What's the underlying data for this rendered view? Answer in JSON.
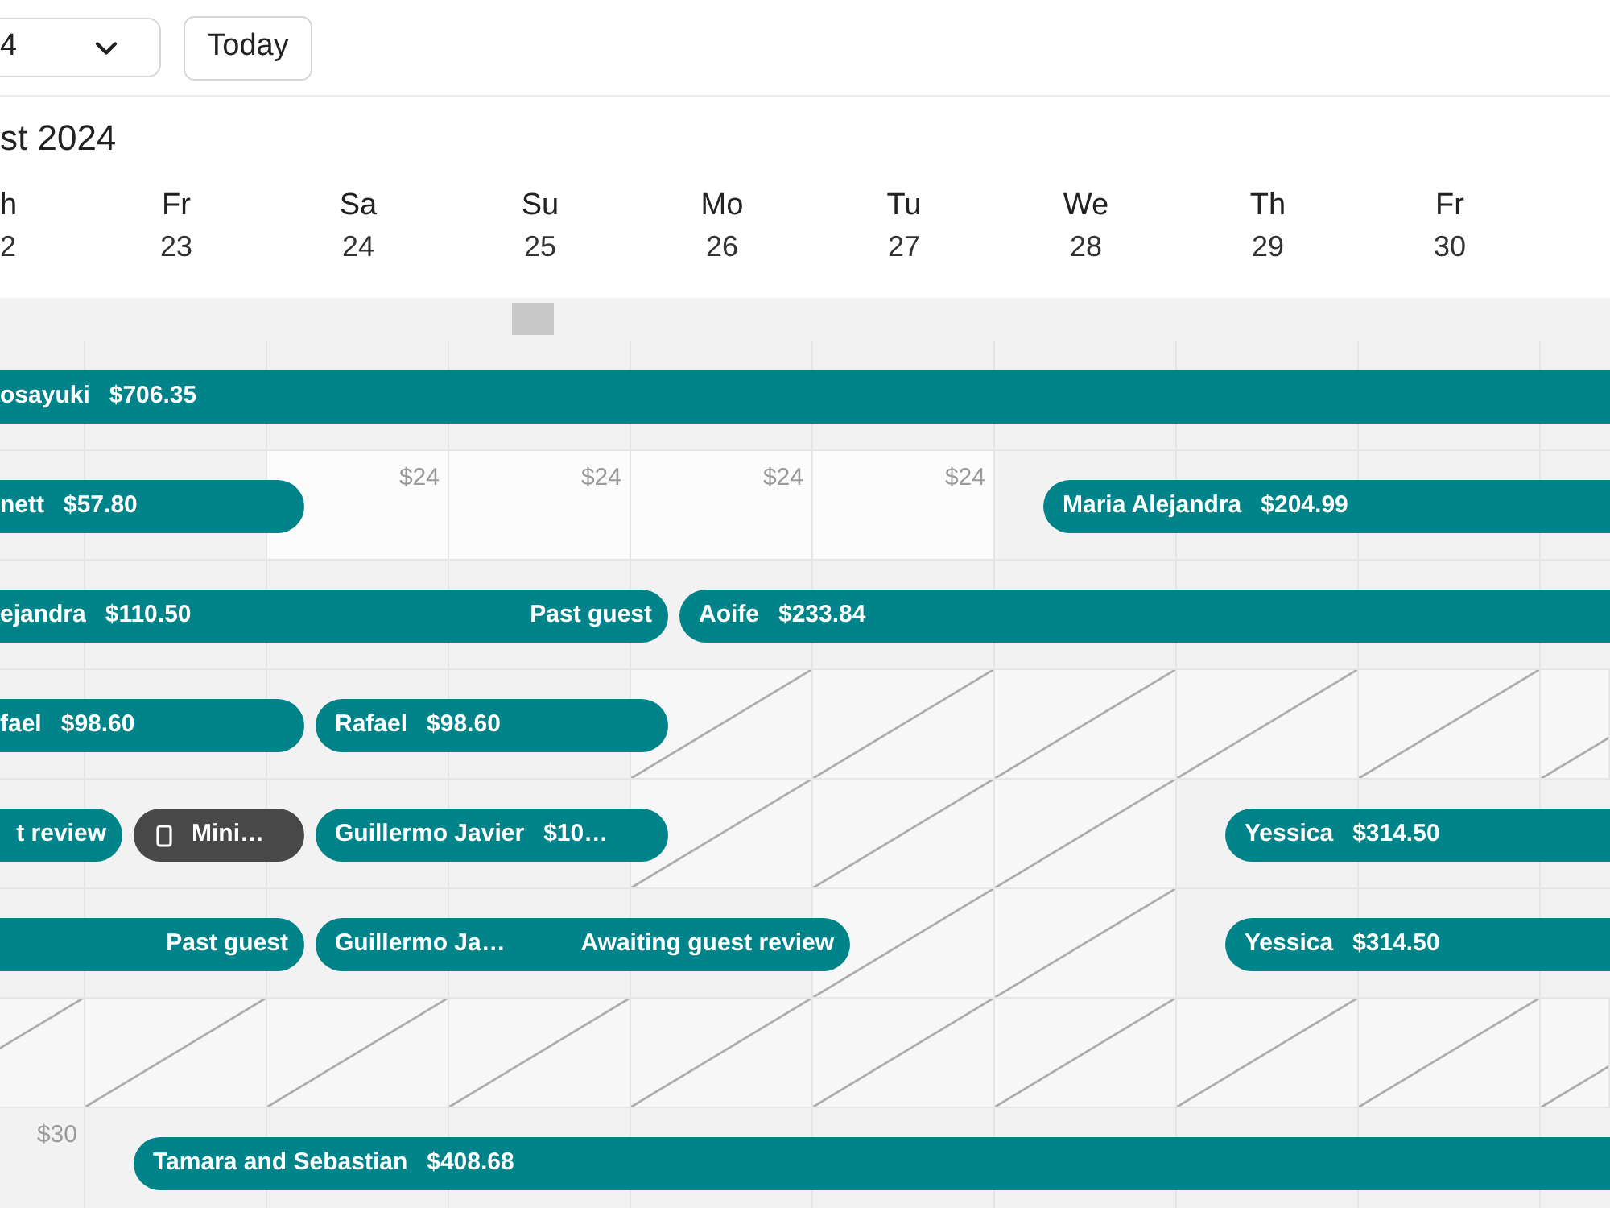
{
  "toolbar": {
    "month_select": {
      "value": "4"
    },
    "today_button": "Today"
  },
  "month_title": "st 2024",
  "days": [
    {
      "weekday": "h",
      "date": "2"
    },
    {
      "weekday": "Fr",
      "date": "23"
    },
    {
      "weekday": "Sa",
      "date": "24"
    },
    {
      "weekday": "Su",
      "date": "25"
    },
    {
      "weekday": "Mo",
      "date": "26"
    },
    {
      "weekday": "Tu",
      "date": "27"
    },
    {
      "weekday": "We",
      "date": "28"
    },
    {
      "weekday": "Th",
      "date": "29"
    },
    {
      "weekday": "Fr",
      "date": "30"
    }
  ],
  "rows": [
    {
      "cells": [
        {
          "kind": "plain",
          "check_in": false,
          "check_out": false
        },
        {
          "kind": "plain",
          "check_in": false,
          "check_out": false
        },
        {
          "kind": "plain",
          "check_in": false,
          "check_out": false
        },
        {
          "kind": "plain",
          "check_in": false,
          "check_out": false
        },
        {
          "kind": "plain",
          "check_in": false,
          "check_out": false
        },
        {
          "kind": "plain",
          "check_in": false,
          "check_out": false
        },
        {
          "kind": "plain",
          "check_in": false,
          "check_out": false
        },
        {
          "kind": "plain",
          "check_in": false,
          "check_out": false
        },
        {
          "kind": "plain",
          "check_in": false,
          "check_out": false
        },
        {
          "kind": "plain",
          "check_in": false,
          "check_out": false
        }
      ],
      "bookings": [
        {
          "kind": "reservation",
          "guest": "osayuki",
          "amount": "$706.35"
        }
      ]
    },
    {
      "cells": [
        {
          "kind": "plain",
          "check_in": false,
          "check_out": false
        },
        {
          "kind": "plain",
          "check_in": false,
          "check_out": false
        },
        {
          "kind": "open",
          "price": "$24",
          "check_in": false,
          "check_out": true
        },
        {
          "kind": "open",
          "price": "$24",
          "check_in": false,
          "check_out": false
        },
        {
          "kind": "open",
          "price": "$24",
          "check_in": false,
          "check_out": false
        },
        {
          "kind": "open",
          "price": "$24",
          "check_in": false,
          "check_out": false
        },
        {
          "kind": "plain",
          "check_in": true,
          "check_out": false
        },
        {
          "kind": "plain",
          "check_in": false,
          "check_out": false
        },
        {
          "kind": "plain",
          "check_in": false,
          "check_out": false
        },
        {
          "kind": "plain",
          "check_in": false,
          "check_out": false
        }
      ],
      "bookings": [
        {
          "kind": "reservation",
          "guest": "nett",
          "amount": "$57.80"
        },
        {
          "kind": "reservation",
          "guest": "Maria Alejandra",
          "amount": "$204.99"
        }
      ]
    },
    {
      "cells": [
        {
          "kind": "plain",
          "check_in": false,
          "check_out": false
        },
        {
          "kind": "plain",
          "check_in": false,
          "check_out": false
        },
        {
          "kind": "plain",
          "check_in": false,
          "check_out": false
        },
        {
          "kind": "plain",
          "check_in": false,
          "check_out": false
        },
        {
          "kind": "plain",
          "check_in": true,
          "check_out": true
        },
        {
          "kind": "plain",
          "check_in": false,
          "check_out": false
        },
        {
          "kind": "plain",
          "check_in": false,
          "check_out": false
        },
        {
          "kind": "plain",
          "check_in": false,
          "check_out": false
        },
        {
          "kind": "plain",
          "check_in": false,
          "check_out": false
        },
        {
          "kind": "plain",
          "check_in": false,
          "check_out": false
        }
      ],
      "bookings": [
        {
          "kind": "reservation",
          "guest": "ejandra",
          "amount": "$110.50",
          "status": "Past guest"
        },
        {
          "kind": "reservation",
          "guest": "Aoife",
          "amount": "$233.84"
        }
      ]
    },
    {
      "cells": [
        {
          "kind": "plain",
          "check_in": false,
          "check_out": false
        },
        {
          "kind": "plain",
          "check_in": false,
          "check_out": false
        },
        {
          "kind": "plain",
          "check_in": true,
          "check_out": true
        },
        {
          "kind": "plain",
          "check_in": false,
          "check_out": false
        },
        {
          "kind": "blocked",
          "check_in": false,
          "check_out": true
        },
        {
          "kind": "blocked",
          "check_in": false,
          "check_out": false
        },
        {
          "kind": "blocked",
          "check_in": false,
          "check_out": false
        },
        {
          "kind": "blocked",
          "check_in": false,
          "check_out": false
        },
        {
          "kind": "blocked",
          "check_in": false,
          "check_out": false
        },
        {
          "kind": "blocked",
          "check_in": false,
          "check_out": false
        }
      ],
      "bookings": [
        {
          "kind": "reservation",
          "guest": "fael",
          "amount": "$98.60"
        },
        {
          "kind": "reservation",
          "guest": "Rafael",
          "amount": "$98.60"
        }
      ]
    },
    {
      "cells": [
        {
          "kind": "plain",
          "check_in": false,
          "check_out": false
        },
        {
          "kind": "plain",
          "check_in": true,
          "check_out": true
        },
        {
          "kind": "plain",
          "check_in": true,
          "check_out": true
        },
        {
          "kind": "plain",
          "check_in": false,
          "check_out": false
        },
        {
          "kind": "blocked",
          "check_in": false,
          "check_out": true
        },
        {
          "kind": "blocked",
          "check_in": false,
          "check_out": false
        },
        {
          "kind": "blocked",
          "check_in": false,
          "check_out": false
        },
        {
          "kind": "plain",
          "check_in": true,
          "check_out": false
        },
        {
          "kind": "plain",
          "check_in": false,
          "check_out": false
        },
        {
          "kind": "plain",
          "check_in": false,
          "check_out": false
        }
      ],
      "bookings": [
        {
          "kind": "reservation",
          "status": "t review"
        },
        {
          "kind": "hold",
          "guest": "Mini…"
        },
        {
          "kind": "reservation",
          "guest": "Guillermo Javier",
          "amount": "$10…"
        },
        {
          "kind": "reservation",
          "guest": "Yessica",
          "amount": "$314.50"
        }
      ]
    },
    {
      "cells": [
        {
          "kind": "plain",
          "check_in": false,
          "check_out": false
        },
        {
          "kind": "plain",
          "check_in": false,
          "check_out": false
        },
        {
          "kind": "plain",
          "check_in": true,
          "check_out": true
        },
        {
          "kind": "plain",
          "check_in": false,
          "check_out": false
        },
        {
          "kind": "plain",
          "check_in": false,
          "check_out": false
        },
        {
          "kind": "blocked",
          "check_in": false,
          "check_out": true
        },
        {
          "kind": "blocked",
          "check_in": false,
          "check_out": false
        },
        {
          "kind": "plain",
          "check_in": true,
          "check_out": false
        },
        {
          "kind": "plain",
          "check_in": false,
          "check_out": false
        },
        {
          "kind": "plain",
          "check_in": false,
          "check_out": false
        }
      ],
      "bookings": [
        {
          "kind": "reservation",
          "status": "Past guest"
        },
        {
          "kind": "reservation",
          "guest": "Guillermo Ja…",
          "status": "Awaiting guest review"
        },
        {
          "kind": "reservation",
          "guest": "Yessica",
          "amount": "$314.50"
        }
      ]
    },
    {
      "cells": [
        {
          "kind": "blocked",
          "check_in": false,
          "check_out": false
        },
        {
          "kind": "blocked",
          "check_in": false,
          "check_out": false
        },
        {
          "kind": "blocked",
          "check_in": false,
          "check_out": false
        },
        {
          "kind": "blocked",
          "check_in": false,
          "check_out": false
        },
        {
          "kind": "blocked",
          "check_in": false,
          "check_out": false
        },
        {
          "kind": "blocked",
          "check_in": false,
          "check_out": false
        },
        {
          "kind": "blocked",
          "check_in": false,
          "check_out": false
        },
        {
          "kind": "blocked",
          "check_in": false,
          "check_out": false
        },
        {
          "kind": "blocked",
          "check_in": false,
          "check_out": false
        },
        {
          "kind": "blocked",
          "check_in": false,
          "check_out": false
        }
      ],
      "bookings": []
    },
    {
      "cells": [
        {
          "kind": "plain",
          "price": "$30",
          "check_in": false,
          "check_out": false
        },
        {
          "kind": "plain",
          "check_in": true,
          "check_out": false
        },
        {
          "kind": "plain",
          "check_in": false,
          "check_out": false
        },
        {
          "kind": "plain",
          "check_in": false,
          "check_out": false
        },
        {
          "kind": "plain",
          "check_in": false,
          "check_out": false
        },
        {
          "kind": "plain",
          "check_in": false,
          "check_out": false
        },
        {
          "kind": "plain",
          "check_in": false,
          "check_out": false
        },
        {
          "kind": "plain",
          "check_in": false,
          "check_out": false
        },
        {
          "kind": "plain",
          "check_in": false,
          "check_out": false
        },
        {
          "kind": "plain",
          "check_in": false,
          "check_out": false
        }
      ],
      "bookings": [
        {
          "kind": "reservation",
          "guest": "Tamara and Sebastian",
          "amount": "$408.68"
        }
      ]
    }
  ]
}
